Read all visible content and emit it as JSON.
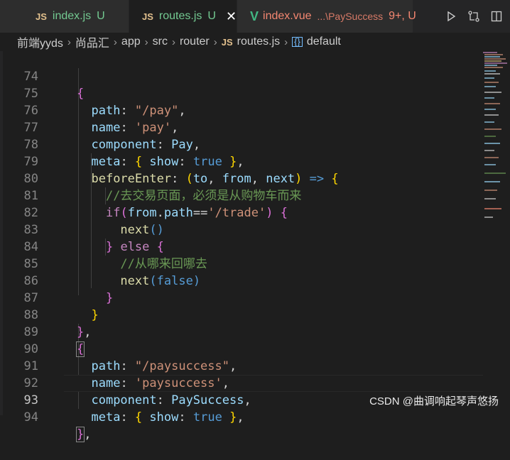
{
  "tabs": [
    {
      "badge": "JS",
      "name": "index.js",
      "status": "U"
    },
    {
      "badge": "JS",
      "name": "routes.js",
      "status": "U",
      "close": "✕"
    },
    {
      "badge": "V",
      "name": "index.vue",
      "desc": "...\\PaySuccess",
      "status": "9+, U"
    }
  ],
  "toolbar": [
    "run-icon",
    "compare-changes-icon",
    "split-editor-icon"
  ],
  "breadcrumb": {
    "items": [
      "前端yyds",
      "尚品汇",
      "app",
      "src",
      "router"
    ],
    "file_badge": "JS",
    "file": "routes.js",
    "symbol_icon": "{}",
    "symbol": "default"
  },
  "lines": [
    {
      "n": "74"
    },
    {
      "n": "75"
    },
    {
      "n": "76"
    },
    {
      "n": "77"
    },
    {
      "n": "78"
    },
    {
      "n": "79"
    },
    {
      "n": "80"
    },
    {
      "n": "81"
    },
    {
      "n": "82"
    },
    {
      "n": "83"
    },
    {
      "n": "84"
    },
    {
      "n": "85"
    },
    {
      "n": "86"
    },
    {
      "n": "87"
    },
    {
      "n": "88"
    },
    {
      "n": "89"
    },
    {
      "n": "90"
    },
    {
      "n": "91"
    },
    {
      "n": "92"
    },
    {
      "n": "93"
    },
    {
      "n": "94"
    }
  ],
  "code": {
    "l74": "{",
    "l75a": "path",
    ":": ":",
    "l75": "path: \"/pay\",",
    "watermark": "CSDN @曲调响起琴声悠扬"
  },
  "colors": {
    "bg": "#1e1e1e",
    "tabbar": "#252526",
    "untracked": "#73c991",
    "error": "#f48771"
  }
}
